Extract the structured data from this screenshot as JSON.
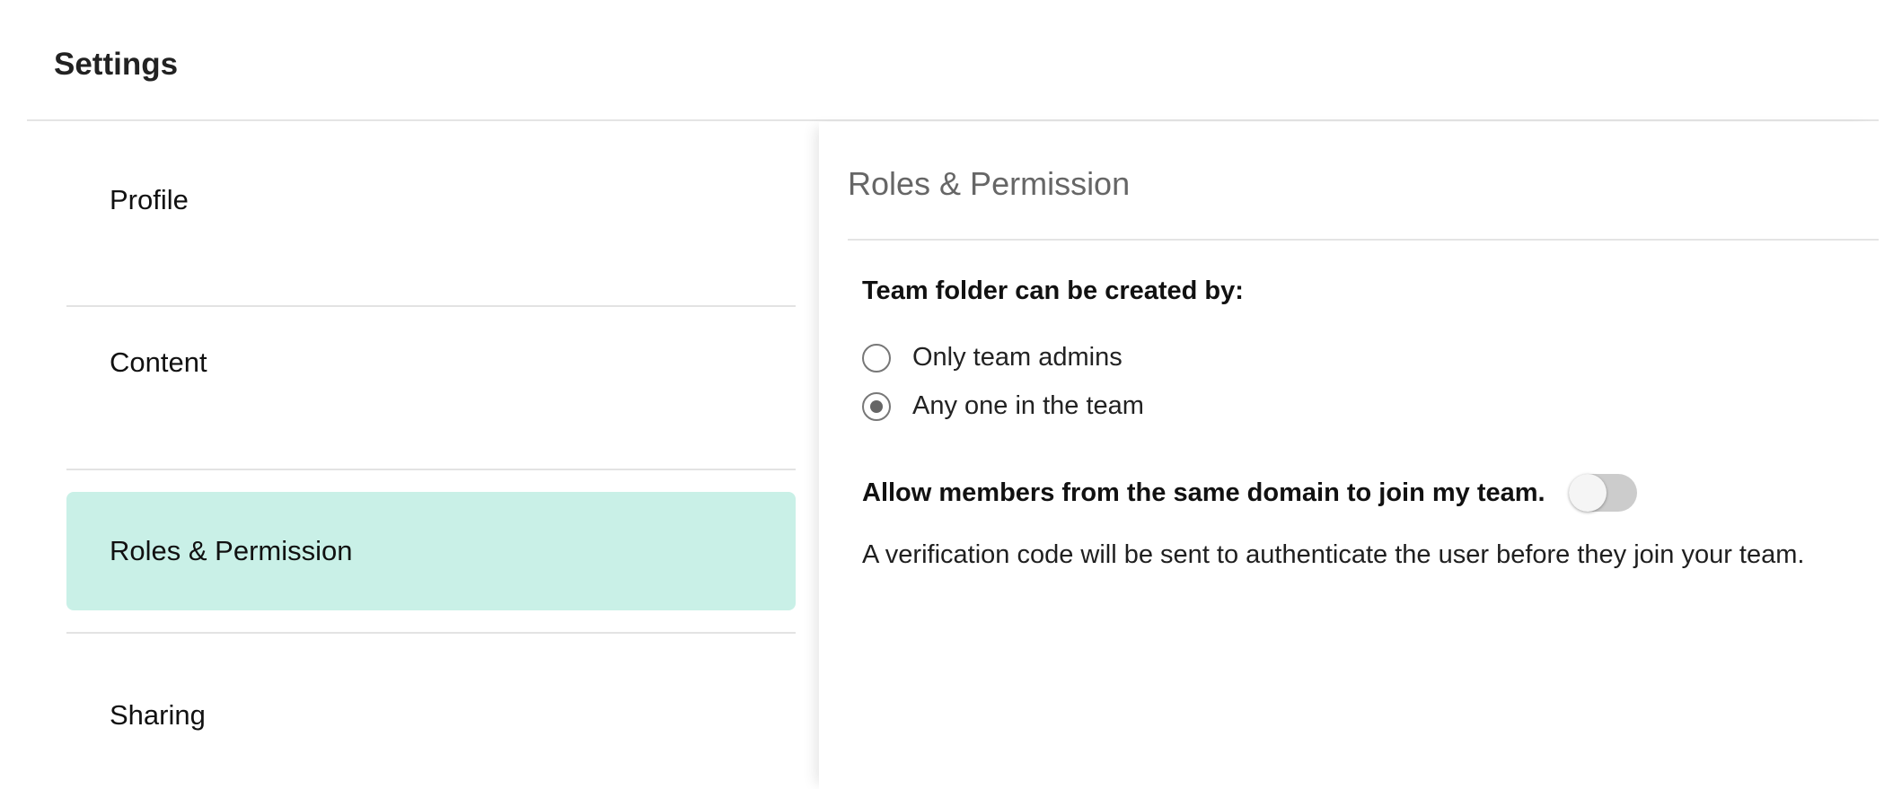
{
  "header": {
    "title": "Settings"
  },
  "sidebar": {
    "items": [
      {
        "label": "Profile",
        "active": false
      },
      {
        "label": "Content",
        "active": false
      },
      {
        "label": "Roles & Permission",
        "active": true
      },
      {
        "label": "Sharing",
        "active": false
      }
    ],
    "active_color": "#c9f0e7"
  },
  "panel": {
    "title": "Roles & Permission",
    "team_folder": {
      "label": "Team folder can be created by:",
      "options": [
        {
          "label": "Only team admins",
          "selected": false
        },
        {
          "label": "Any one in the team",
          "selected": true
        }
      ]
    },
    "domain_join": {
      "label": "Allow members from the same domain to join my team.",
      "enabled": false,
      "helper": "A verification code will be sent to authenticate the user before they join your team."
    }
  }
}
